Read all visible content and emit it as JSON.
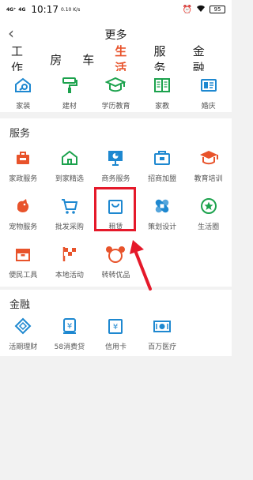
{
  "status": {
    "signal1": "4G⁺",
    "signal2": "4G",
    "time": "10:17",
    "net_speed": "0.10 K/s",
    "battery": "95"
  },
  "header": {
    "back_icon": "chevron-left-icon",
    "title": "更多"
  },
  "category_tabs": [
    {
      "label": "工作",
      "active": false
    },
    {
      "label": "房",
      "active": false
    },
    {
      "label": "车",
      "active": false
    },
    {
      "label": "生活",
      "active": true
    },
    {
      "label": "服务",
      "active": false
    },
    {
      "label": "金融",
      "active": false
    }
  ],
  "life_items": [
    {
      "label": "家装",
      "icon": "wrench-house-icon",
      "color": "#1e88d0"
    },
    {
      "label": "建材",
      "icon": "paint-roller-icon",
      "color": "#1ca24d"
    },
    {
      "label": "学历教育",
      "icon": "graduation-cap-icon",
      "color": "#1ca24d"
    },
    {
      "label": "家教",
      "icon": "open-book-icon",
      "color": "#1ca24d"
    },
    {
      "label": "婚庆",
      "icon": "wedding-card-icon",
      "color": "#1e88d0"
    }
  ],
  "services": {
    "title": "服务",
    "rows": [
      [
        {
          "label": "家政服务",
          "icon": "briefcase-icon",
          "color": "#e8532b"
        },
        {
          "label": "到家精选",
          "icon": "home-icon",
          "color": "#1ca24d"
        },
        {
          "label": "商务服务",
          "icon": "presentation-icon",
          "color": "#1e88d0"
        },
        {
          "label": "招商加盟",
          "icon": "shop-bag-icon",
          "color": "#1e88d0"
        },
        {
          "label": "教育培训",
          "icon": "graduation-cap-icon",
          "color": "#e8532b"
        }
      ],
      [
        {
          "label": "宠物服务",
          "icon": "pet-icon",
          "color": "#e8532b"
        },
        {
          "label": "批发采购",
          "icon": "shopping-cart-icon",
          "color": "#1e88d0"
        },
        {
          "label": "租赁",
          "icon": "rental-bag-icon",
          "color": "#1e88d0"
        },
        {
          "label": "策划设计",
          "icon": "bandage-icon",
          "color": "#1e88d0"
        },
        {
          "label": "生活圈",
          "icon": "star-circle-icon",
          "color": "#1ca24d"
        }
      ],
      [
        {
          "label": "便民工具",
          "icon": "toolbox-icon",
          "color": "#e8532b"
        },
        {
          "label": "本地活动",
          "icon": "flag-icon",
          "color": "#e8532b"
        },
        {
          "label": "转转优品",
          "icon": "zhuanzhuan-logo-icon",
          "color": "#e8532b"
        }
      ]
    ]
  },
  "finance": {
    "title": "金融",
    "items": [
      {
        "label": "活期理财",
        "icon": "piggy-diamond-icon",
        "color": "#1e88d0"
      },
      {
        "label": "58消费贷",
        "icon": "yen-bag-icon",
        "color": "#1e88d0"
      },
      {
        "label": "信用卡",
        "icon": "credit-card-icon",
        "color": "#1e88d0"
      },
      {
        "label": "百万医疗",
        "icon": "medical-cash-icon",
        "color": "#1e88d0"
      }
    ]
  },
  "annotation": {
    "box_color": "#e5192a",
    "arrow_color": "#e5192a"
  }
}
